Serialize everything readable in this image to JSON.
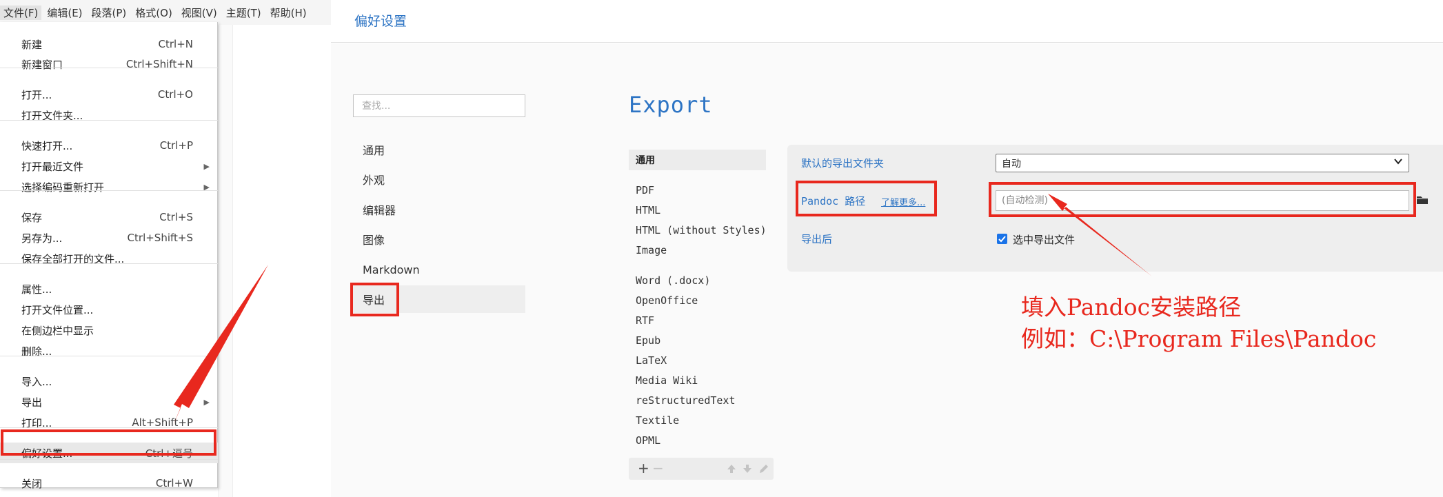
{
  "menubar": [
    {
      "label": "文件(F)"
    },
    {
      "label": "编辑(E)"
    },
    {
      "label": "段落(P)"
    },
    {
      "label": "格式(O)"
    },
    {
      "label": "视图(V)"
    },
    {
      "label": "主题(T)"
    },
    {
      "label": "帮助(H)"
    }
  ],
  "file_menu": {
    "items": [
      {
        "label": "新建",
        "shortcut": "Ctrl+N"
      },
      {
        "label": "新建窗口",
        "shortcut": "Ctrl+Shift+N"
      },
      {
        "label": "打开...",
        "shortcut": "Ctrl+O"
      },
      {
        "label": "打开文件夹...",
        "shortcut": ""
      },
      {
        "label": "快速打开...",
        "shortcut": "Ctrl+P"
      },
      {
        "label": "打开最近文件",
        "shortcut": ""
      },
      {
        "label": "选择编码重新打开",
        "shortcut": ""
      },
      {
        "label": "保存",
        "shortcut": "Ctrl+S"
      },
      {
        "label": "另存为...",
        "shortcut": "Ctrl+Shift+S"
      },
      {
        "label": "保存全部打开的文件...",
        "shortcut": ""
      },
      {
        "label": "属性...",
        "shortcut": ""
      },
      {
        "label": "打开文件位置...",
        "shortcut": ""
      },
      {
        "label": "在侧边栏中显示",
        "shortcut": ""
      },
      {
        "label": "删除...",
        "shortcut": ""
      },
      {
        "label": "导入...",
        "shortcut": ""
      },
      {
        "label": "导出",
        "shortcut": ""
      },
      {
        "label": "打印...",
        "shortcut": "Alt+Shift+P"
      },
      {
        "label": "偏好设置...",
        "shortcut": "Ctrl+逗号"
      },
      {
        "label": "关闭",
        "shortcut": "Ctrl+W"
      }
    ]
  },
  "preferences": {
    "title": "偏好设置",
    "search_placeholder": "查找...",
    "categories": [
      "通用",
      "外观",
      "编辑器",
      "图像",
      "Markdown",
      "导出"
    ],
    "export_heading": "Export",
    "format_group_header": "通用",
    "formats": [
      "PDF",
      "HTML",
      "HTML (without Styles)",
      "Image",
      "Word (.docx)",
      "OpenOffice",
      "RTF",
      "Epub",
      "LaTeX",
      "Media Wiki",
      "reStructuredText",
      "Textile",
      "OPML"
    ],
    "toolbar": {
      "add": "+",
      "remove": "−"
    },
    "settings": {
      "default_folder_label": "默认的导出文件夹",
      "default_folder_value": "自动",
      "pandoc_label": "Pandoc 路径",
      "learn_more": "了解更多...",
      "pandoc_placeholder": "(自动检测)",
      "after_export_label": "导出后",
      "select_file_label": "选中导出文件",
      "select_file_checked": true
    }
  },
  "annotation": {
    "line1": "填入Pandoc安装路径",
    "line2": "例如：C:\\Program Files\\Pandoc"
  },
  "colors": {
    "accent": "#2d74c4",
    "annotation_red": "#e8281e",
    "checkbox_blue": "#1a73e8"
  }
}
